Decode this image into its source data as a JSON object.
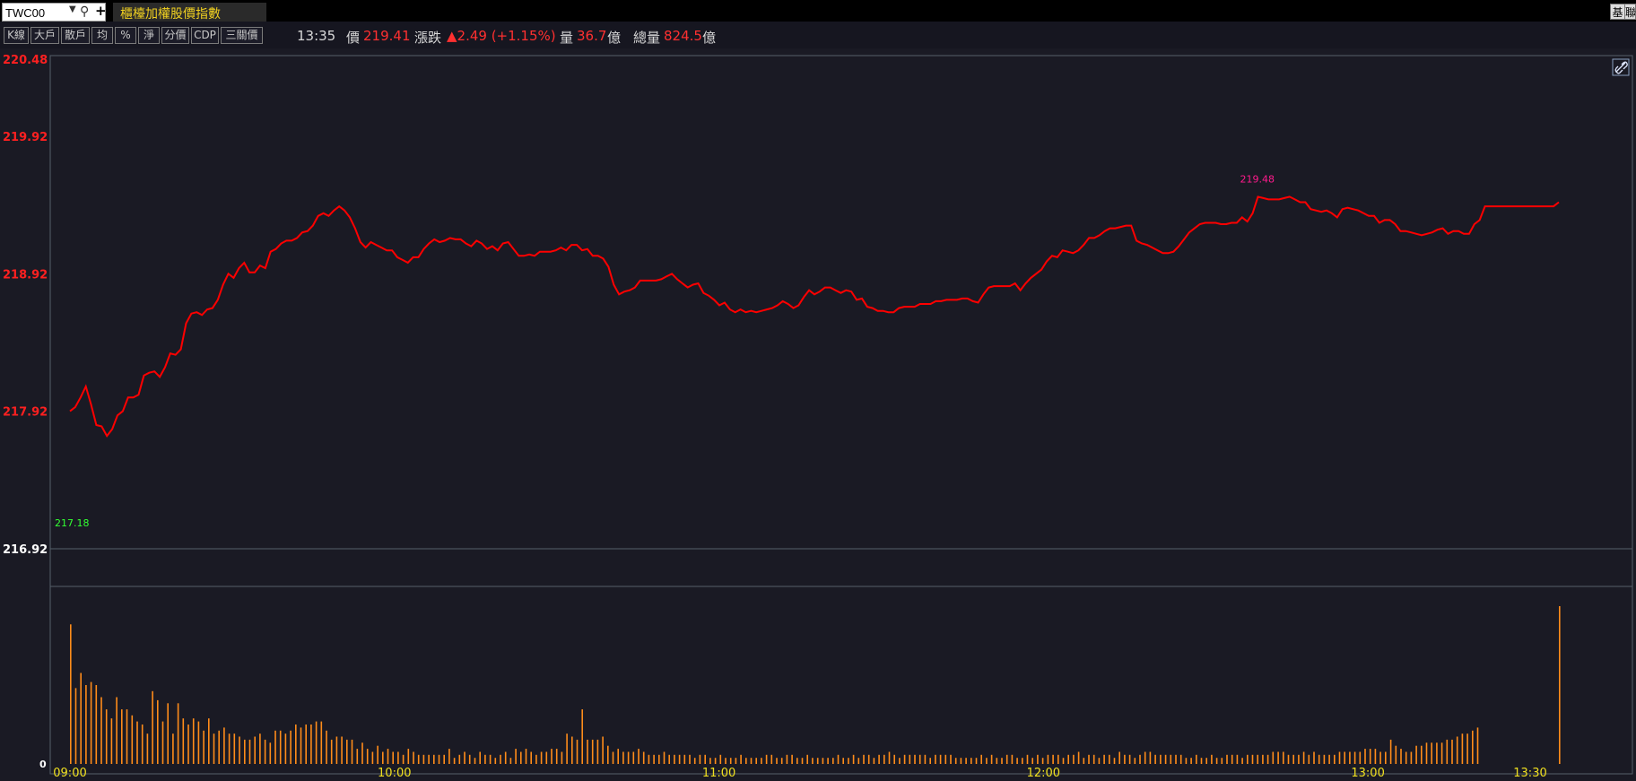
{
  "topbar": {
    "symbol": "TWC00",
    "index_name": "櫃檯加權股價指數",
    "right_buttons": [
      "基",
      "聯"
    ]
  },
  "toolbar": {
    "buttons": [
      "K線",
      "大戶",
      "散戶",
      "均",
      "%",
      "淨",
      "分價",
      "CDP",
      "三關價"
    ],
    "time": "13:35",
    "price_label": "價",
    "price": "219.41",
    "change_label": "漲跌",
    "change": "▲2.49 (+1.15%)",
    "volume_label": "量",
    "volume": "36.7",
    "volume_unit": "億",
    "total_volume_label": "總量",
    "total_volume": "824.5",
    "total_volume_unit": "億"
  },
  "colors": {
    "price_line": "#ff0000",
    "volume_bar": "#ff8c1a",
    "high_label": "#ff1a8c",
    "low_label": "#33ff33",
    "up_text": "#ff3030",
    "time_axis": "#f0e020",
    "background": "#1a1a24"
  },
  "chart_data": [
    {
      "type": "line",
      "series": [
        {
          "values": [
            217.92,
            217.95,
            218.02,
            218.1,
            217.97,
            217.82,
            217.81,
            217.74,
            217.79,
            217.89,
            217.92,
            218.02,
            218.02,
            218.04,
            218.18,
            218.2,
            218.21,
            218.17,
            218.24,
            218.34,
            218.33,
            218.37,
            218.56,
            218.63,
            218.64,
            218.62,
            218.66,
            218.67,
            218.73,
            218.84,
            218.92,
            218.89,
            218.96,
            219.0,
            218.93,
            218.93,
            218.98,
            218.96,
            219.08,
            219.1,
            219.14,
            219.16,
            219.16,
            219.18,
            219.22,
            219.23,
            219.27,
            219.34,
            219.36,
            219.34,
            219.38,
            219.41,
            219.38,
            219.33,
            219.25,
            219.15,
            219.11,
            219.15,
            219.13,
            219.11,
            219.09,
            219.09,
            219.04,
            219.02,
            219.0,
            219.04,
            219.04,
            219.1,
            219.14,
            219.17,
            219.15,
            219.16,
            219.18,
            219.17,
            219.17,
            219.14,
            219.12,
            219.16,
            219.14,
            219.1,
            219.12,
            219.09,
            219.14,
            219.15,
            219.1,
            219.05,
            219.05,
            219.06,
            219.05,
            219.08,
            219.08,
            219.08,
            219.09,
            219.11,
            219.09,
            219.13,
            219.13,
            219.09,
            219.1,
            219.05,
            219.05,
            219.03,
            218.97,
            218.84,
            218.77,
            218.79,
            218.8,
            218.82,
            218.87,
            218.87,
            218.87,
            218.87,
            218.88,
            218.9,
            218.92,
            218.88,
            218.85,
            218.82,
            218.84,
            218.85,
            218.78,
            218.76,
            218.73,
            218.69,
            218.71,
            218.66,
            218.64,
            218.66,
            218.64,
            218.65,
            218.64,
            218.65,
            218.66,
            218.67,
            218.69,
            218.72,
            218.7,
            218.67,
            218.69,
            218.75,
            218.8,
            218.77,
            218.79,
            218.82,
            218.82,
            218.8,
            218.78,
            218.8,
            218.79,
            218.73,
            218.74,
            218.68,
            218.67,
            218.65,
            218.65,
            218.64,
            218.64,
            218.67,
            218.68,
            218.68,
            218.68,
            218.7,
            218.7,
            218.7,
            218.72,
            218.72,
            218.73,
            218.73,
            218.73,
            218.74,
            218.74,
            218.72,
            218.71,
            218.77,
            218.82,
            218.83,
            218.83,
            218.83,
            218.83,
            218.85,
            218.8,
            218.85,
            218.89,
            218.92,
            218.95,
            219.01,
            219.05,
            219.04,
            219.09,
            219.08,
            219.07,
            219.09,
            219.13,
            219.18,
            219.18,
            219.2,
            219.23,
            219.25,
            219.25,
            219.26,
            219.27,
            219.27,
            219.16,
            219.14,
            219.13,
            219.11,
            219.09,
            219.07,
            219.07,
            219.08,
            219.12,
            219.17,
            219.22,
            219.25,
            219.28,
            219.29,
            219.29,
            219.29,
            219.28,
            219.28,
            219.29,
            219.29,
            219.33,
            219.3,
            219.36,
            219.48,
            219.47,
            219.46,
            219.46,
            219.46,
            219.47,
            219.48,
            219.46,
            219.44,
            219.44,
            219.39,
            219.38,
            219.37,
            219.38,
            219.36,
            219.33,
            219.39,
            219.4,
            219.39,
            219.38,
            219.36,
            219.34,
            219.34,
            219.29,
            219.31,
            219.31,
            219.28,
            219.23,
            219.23,
            219.22,
            219.21,
            219.2,
            219.21,
            219.22,
            219.24,
            219.25,
            219.21,
            219.23,
            219.23,
            219.21,
            219.21,
            219.28,
            219.31,
            219.41,
            219.41,
            219.41,
            219.41,
            219.41,
            219.41,
            219.41,
            219.41,
            219.41,
            219.41,
            219.41,
            219.41,
            219.41,
            219.41,
            219.44
          ]
        }
      ],
      "x_range": [
        "09:00",
        "13:30"
      ],
      "x_ticks": [
        "09:00",
        "10:00",
        "11:00",
        "12:00",
        "13:00",
        "13:30"
      ],
      "y_ticks": [
        "220.48",
        "219.92",
        "218.92",
        "217.92",
        "216.92"
      ],
      "ylim": [
        216.92,
        220.48
      ],
      "annotations": [
        {
          "text": "219.48",
          "kind": "high"
        },
        {
          "text": "217.18",
          "kind": "low"
        }
      ]
    },
    {
      "type": "bar",
      "ylabel_tick": "0",
      "values": [
        46,
        25,
        30,
        26,
        27,
        26,
        22,
        18,
        15,
        22,
        18,
        18,
        16,
        14,
        13,
        10,
        24,
        21,
        14,
        20,
        10,
        20,
        15,
        13,
        15,
        14,
        11,
        15,
        10,
        11,
        12,
        10,
        10,
        9,
        8,
        8,
        9,
        10,
        8,
        7,
        11,
        11,
        10,
        11,
        13,
        12,
        13,
        13,
        14,
        14,
        11,
        8,
        9,
        9,
        8,
        8,
        5,
        7,
        5,
        4,
        6,
        4,
        5,
        4,
        4,
        3,
        5,
        4,
        3,
        3,
        3,
        3,
        3,
        3,
        5,
        2,
        3,
        4,
        3,
        2,
        4,
        3,
        3,
        2,
        3,
        4,
        2,
        5,
        4,
        5,
        4,
        3,
        4,
        4,
        5,
        5,
        4,
        10,
        9,
        8,
        18,
        8,
        8,
        8,
        9,
        6,
        4,
        5,
        4,
        4,
        4,
        5,
        4,
        3,
        3,
        3,
        4,
        3,
        3,
        3,
        3,
        3,
        2,
        3,
        3,
        2,
        2,
        3,
        2,
        2,
        2,
        3,
        2,
        2,
        2,
        2,
        3,
        3,
        2,
        2,
        3,
        3,
        2,
        2,
        3,
        2,
        2,
        2,
        2,
        2,
        3,
        2,
        2,
        3,
        2,
        3,
        3,
        2,
        3,
        3,
        4,
        3,
        2,
        3,
        3,
        3,
        3,
        3,
        2,
        3,
        3,
        3,
        3,
        2,
        2,
        2,
        2,
        2,
        3,
        2,
        3,
        2,
        2,
        3,
        3,
        2,
        2,
        3,
        2,
        3,
        2,
        3,
        3,
        3,
        2,
        3,
        3,
        4,
        2,
        3,
        3,
        2,
        3,
        3,
        2,
        4,
        3,
        3,
        2,
        3,
        4,
        4,
        3,
        3,
        3,
        3,
        3,
        3,
        2,
        2,
        3,
        2,
        2,
        3,
        2,
        2,
        3,
        3,
        3,
        2,
        3,
        3,
        3,
        3,
        3,
        4,
        4,
        4,
        3,
        3,
        3,
        4,
        3,
        4,
        3,
        3,
        3,
        3,
        4,
        4,
        4,
        4,
        4,
        5,
        5,
        5,
        4,
        4,
        8,
        6,
        5,
        4,
        4,
        6,
        6,
        7,
        7,
        7,
        7,
        8,
        8,
        9,
        10,
        10,
        11,
        12,
        0,
        0,
        0,
        0,
        0,
        0,
        0,
        0,
        0,
        0,
        0,
        0,
        0,
        0,
        0,
        52
      ]
    }
  ]
}
